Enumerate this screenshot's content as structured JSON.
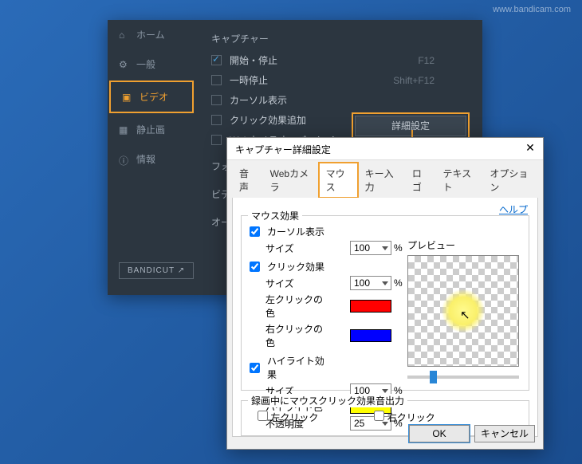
{
  "watermark": "www.bandicam.com",
  "sidebar": {
    "items": [
      {
        "icon": "home",
        "label": "ホーム"
      },
      {
        "icon": "gear",
        "label": "一般"
      },
      {
        "icon": "video",
        "label": "ビデオ"
      },
      {
        "icon": "image",
        "label": "静止画"
      },
      {
        "icon": "info",
        "label": "情報"
      }
    ],
    "bandicut": "BANDICUT ↗"
  },
  "content": {
    "section_title": "キャプチャー",
    "rows": [
      {
        "checked": true,
        "label": "開始・停止",
        "hotkey": "F12"
      },
      {
        "checked": false,
        "label": "一時停止",
        "hotkey": "Shift+F12"
      },
      {
        "checked": false,
        "label": "カーソル表示"
      },
      {
        "checked": false,
        "label": "クリック効果追加"
      },
      {
        "checked": false,
        "label": "Webカメラオーバーレイ"
      }
    ],
    "adv_button": "詳細設定",
    "other": [
      "フォー",
      "ビデオ",
      "オーデ"
    ]
  },
  "dialog": {
    "title": "キャプチャー詳細設定",
    "tabs": [
      "音声",
      "Webカメラ",
      "マウス",
      "キー入力",
      "ロゴ",
      "テキスト",
      "オプション"
    ],
    "active_tab": 2,
    "help": "ヘルプ",
    "group1": {
      "title": "マウス効果",
      "cursor_show": "カーソル表示",
      "size": "サイズ",
      "click_effect": "クリック効果",
      "left_color": "左クリックの色",
      "right_color": "右クリックの色",
      "highlight_effect": "ハイライト効果",
      "highlight_color": "ハイライト色",
      "opacity": "不透明度",
      "size1": "100",
      "size2": "100",
      "size3": "100",
      "opacity_val": "25",
      "preview": "プレビュー",
      "colors": {
        "left": "#ff0000",
        "right": "#0000ff",
        "highlight": "#ffff00"
      }
    },
    "group2": {
      "title": "録画中にマウスクリック効果音出力",
      "left": "左クリック",
      "right": "右クリック"
    },
    "ok": "OK",
    "cancel": "キャンセル"
  }
}
